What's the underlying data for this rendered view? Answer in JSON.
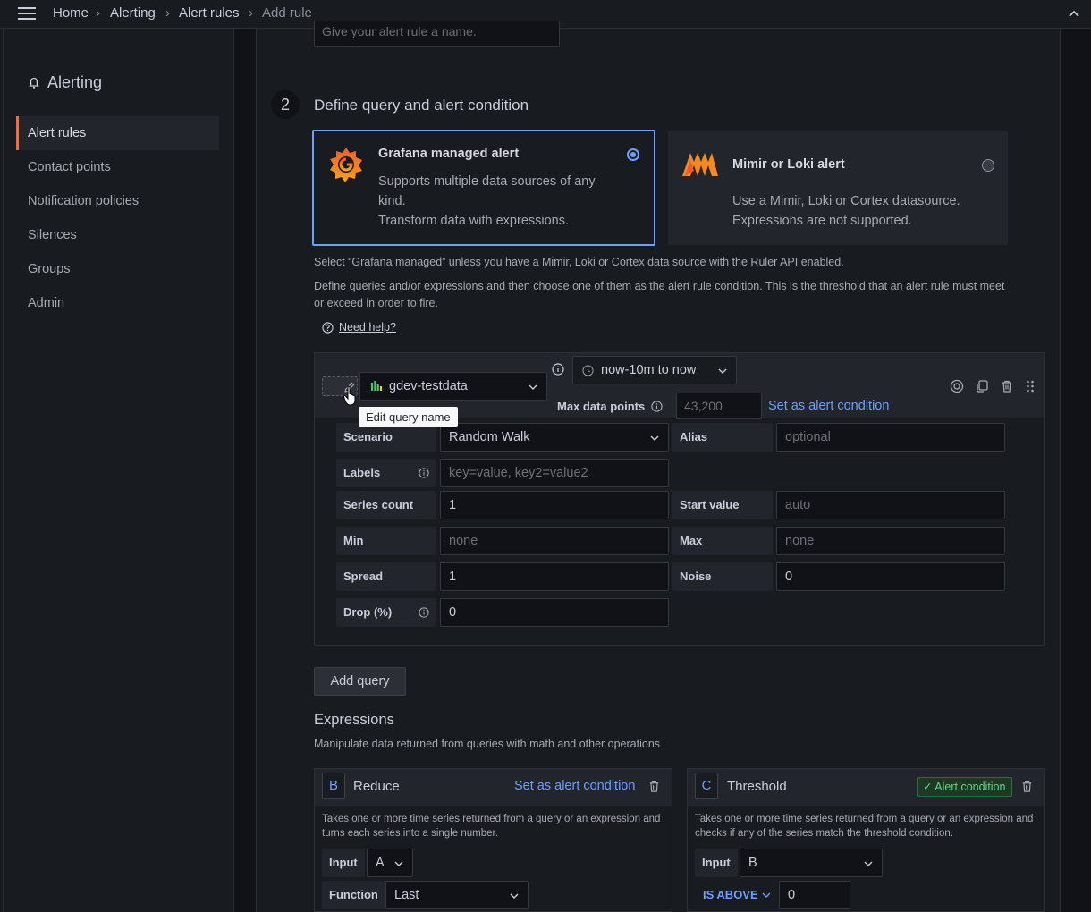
{
  "breadcrumb": {
    "home": "Home",
    "alerting": "Alerting",
    "alert_rules": "Alert rules",
    "current": "Add rule"
  },
  "sidebar": {
    "title": "Alerting",
    "items": [
      {
        "label": "Alert rules",
        "active": true
      },
      {
        "label": "Contact points"
      },
      {
        "label": "Notification policies"
      },
      {
        "label": "Silences"
      },
      {
        "label": "Groups"
      },
      {
        "label": "Admin"
      }
    ]
  },
  "rule_name": {
    "placeholder": "Give your alert rule a name."
  },
  "step2": {
    "number": "2",
    "title": "Define query and alert condition",
    "grafana_card": {
      "title": "Grafana managed alert",
      "desc_line1": "Supports multiple data sources of any",
      "desc_line2": "kind.",
      "desc_line3": "Transform data with expressions.",
      "selected": true
    },
    "mimir_card": {
      "title": "Mimir or Loki alert",
      "desc_line1": "Use a Mimir, Loki or Cortex datasource.",
      "desc_line2": "Expressions are not supported.",
      "selected": false
    },
    "help1": "Select “Grafana managed” unless you have a Mimir, Loki or Cortex data source with the Ruler API enabled.",
    "help2_line1": "Define queries and/or expressions and then choose one of them as the alert rule condition. This is the threshold that an alert rule must meet",
    "help2_line2": "or exceed in order to fire.",
    "need_help": "Need help?"
  },
  "query": {
    "datasource": "gdev-testdata",
    "tooltip": "Edit query name",
    "time_range": "now-10m to now",
    "max_data_points_label": "Max data points",
    "max_data_points_placeholder": "43,200",
    "set_condition": "Set as alert condition",
    "fields": {
      "scenario_label": "Scenario",
      "scenario_value": "Random Walk",
      "alias_label": "Alias",
      "alias_placeholder": "optional",
      "labels_label": "Labels",
      "labels_placeholder": "key=value, key2=value2",
      "series_count_label": "Series count",
      "series_count_value": "1",
      "start_value_label": "Start value",
      "start_value_placeholder": "auto",
      "min_label": "Min",
      "min_placeholder": "none",
      "max_label": "Max",
      "max_placeholder": "none",
      "spread_label": "Spread",
      "spread_value": "1",
      "noise_label": "Noise",
      "noise_value": "0",
      "drop_label": "Drop (%)",
      "drop_value": "0"
    },
    "add_query": "Add query"
  },
  "expressions": {
    "title": "Expressions",
    "subtitle": "Manipulate data returned from queries with math and other operations",
    "reduce": {
      "ref": "B",
      "name": "Reduce",
      "set_condition": "Set as alert condition",
      "desc_line1": "Takes one or more time series returned from a query or an expression and",
      "desc_line2": "turns each series into a single number.",
      "input_label": "Input",
      "input_value": "A",
      "function_label": "Function",
      "function_value": "Last"
    },
    "threshold": {
      "ref": "C",
      "name": "Threshold",
      "badge": "Alert condition",
      "desc_line1": "Takes one or more time series returned from a query or an expression and",
      "desc_line2": "checks if any of the series match the threshold condition.",
      "input_label": "Input",
      "input_value": "B",
      "operator": "IS ABOVE",
      "value": "0"
    }
  },
  "colors": {
    "accent": "#6e9fff",
    "brand": "#f46c3c",
    "success": "#6ccf8e"
  }
}
